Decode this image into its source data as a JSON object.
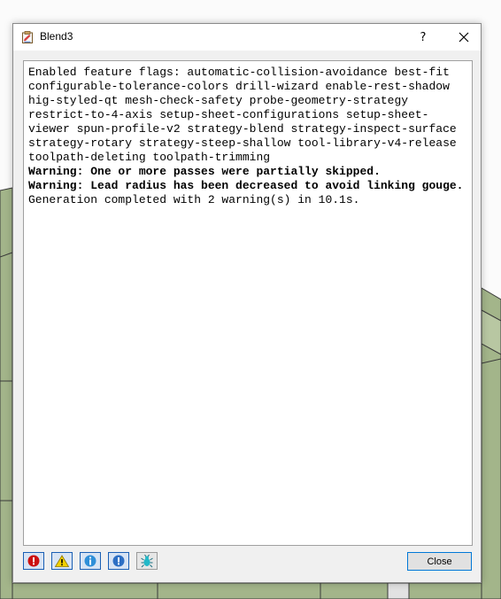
{
  "window": {
    "title": "Blend3",
    "help_label": "?"
  },
  "log": {
    "lines": [
      {
        "text": "Enabled feature flags: automatic-collision-avoidance best-fit configurable-tolerance-colors drill-wizard enable-rest-shadow hig-styled-qt mesh-check-safety probe-geometry-strategy restrict-to-4-axis setup-sheet-configurations setup-sheet-viewer spun-profile-v2 strategy-blend strategy-inspect-surface strategy-rotary strategy-steep-shallow tool-library-v4-release toolpath-deleting toolpath-trimming",
        "bold": false
      },
      {
        "text": "Warning: One or more passes were partially skipped.",
        "bold": true
      },
      {
        "text": "Warning: Lead radius has been decreased to avoid linking gouge.",
        "bold": true
      },
      {
        "text": "Generation completed with 2 warning(s) in 10.1s.",
        "bold": false
      }
    ]
  },
  "filters": [
    {
      "name": "error-filter",
      "icon": "error-icon",
      "color": "#cc1111"
    },
    {
      "name": "warning-filter",
      "icon": "warning-icon",
      "color": "#f2d000"
    },
    {
      "name": "info-filter",
      "icon": "info-icon",
      "color": "#2f8fd8"
    },
    {
      "name": "important-filter",
      "icon": "important-icon",
      "color": "#2d6fc4"
    },
    {
      "name": "debug-filter",
      "icon": "bug-icon",
      "color": "#22b8c8"
    }
  ],
  "footer": {
    "close_label": "Close"
  },
  "colors": {
    "viewport_green": "#a3b58a",
    "accent_blue": "#0078d7"
  }
}
